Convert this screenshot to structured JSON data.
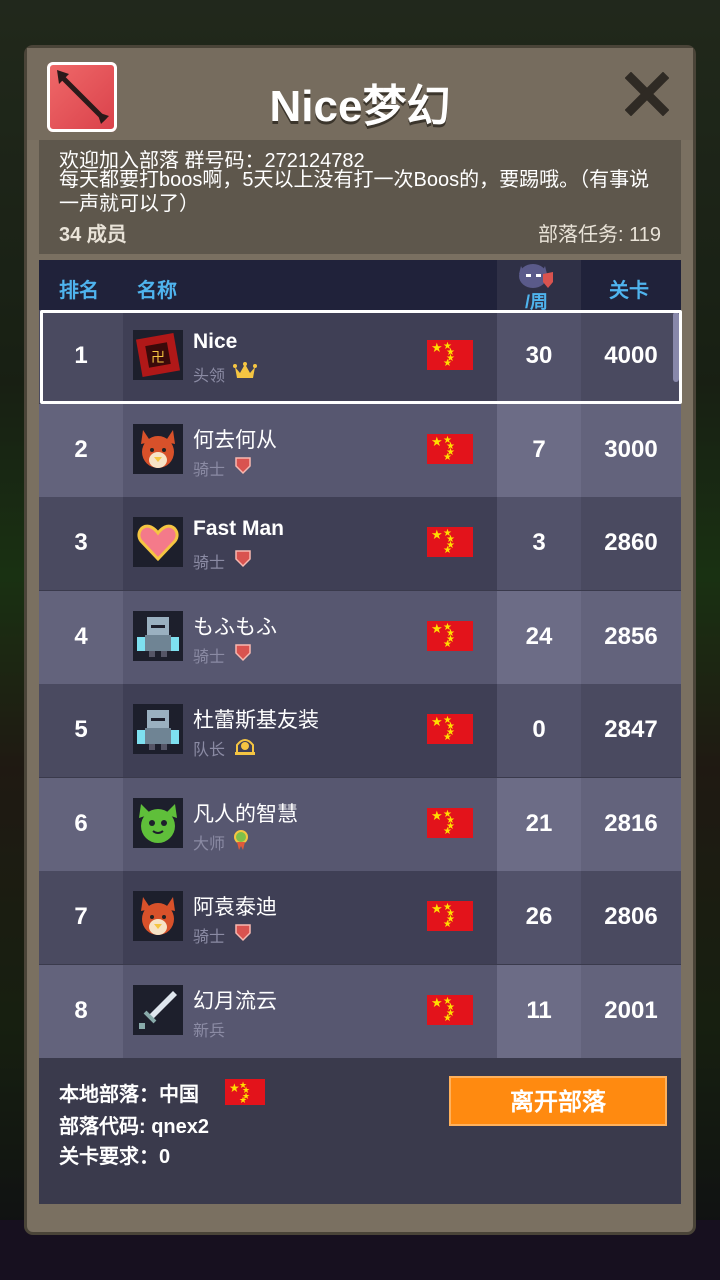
{
  "tribe": {
    "title": "Nice梦幻",
    "welcome_line": "欢迎加入部落 群号码：272124782",
    "notice": "每天都要打boos啊，5天以上没有打一次Boos的，要踢哦。（有事说一声就可以了）",
    "members": "34 成员",
    "task": "部落任务: 119"
  },
  "table": {
    "headers": {
      "rank": "排名",
      "name": "名称",
      "week": "/周",
      "level": "关卡"
    },
    "rows": [
      {
        "rank": "1",
        "name": "Nice",
        "role": "头领",
        "role_icon": "crown-icon",
        "avatar": "red-book-icon",
        "week": "30",
        "level": "4000",
        "selected": true,
        "bold": true
      },
      {
        "rank": "2",
        "name": "何去何从",
        "role": "骑士",
        "role_icon": "shield-icon",
        "avatar": "fox-icon",
        "week": "7",
        "level": "3000"
      },
      {
        "rank": "3",
        "name": "Fast Man",
        "role": "骑士",
        "role_icon": "shield-icon",
        "avatar": "heart-icon",
        "week": "3",
        "level": "2860",
        "bold": true
      },
      {
        "rank": "4",
        "name": "もふもふ",
        "role": "骑士",
        "role_icon": "shield-icon",
        "avatar": "knight-icon",
        "week": "24",
        "level": "2856"
      },
      {
        "rank": "5",
        "name": "杜蕾斯基友装",
        "role": "队长",
        "role_icon": "helmet-icon",
        "avatar": "knight-icon",
        "week": "0",
        "level": "2847"
      },
      {
        "rank": "6",
        "name": "凡人的智慧",
        "role": "大师",
        "role_icon": "medal-icon",
        "avatar": "green-cat-icon",
        "week": "21",
        "level": "2816"
      },
      {
        "rank": "7",
        "name": "阿袁泰迪",
        "role": "骑士",
        "role_icon": "shield-icon",
        "avatar": "fox-icon",
        "week": "26",
        "level": "2806"
      },
      {
        "rank": "8",
        "name": "幻月流云",
        "role": "新兵",
        "role_icon": "",
        "avatar": "sword-icon",
        "week": "11",
        "level": "2001"
      }
    ]
  },
  "footer": {
    "local_tribe": "本地部落：中国",
    "tribe_code": "部落代码: qnex2",
    "level_req": "关卡要求：0",
    "leave_label": "离开部落"
  },
  "colors": {
    "header_blue": "#4fb4ee",
    "leave_orange": "#ff8a10",
    "flag_red": "#e3131b"
  }
}
